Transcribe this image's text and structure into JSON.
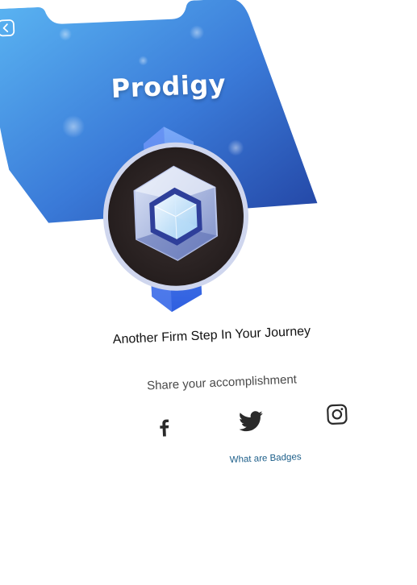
{
  "header": {
    "title": "Prodigy",
    "back_icon": "chevron-left-icon"
  },
  "badge": {
    "icon": "hexagon-gem-icon"
  },
  "main": {
    "tagline": "Another Firm Step In Your Journey",
    "share_label": "Share your accomplishment",
    "social": [
      {
        "name": "facebook",
        "icon": "facebook-icon"
      },
      {
        "name": "twitter",
        "icon": "twitter-icon"
      },
      {
        "name": "instagram",
        "icon": "instagram-icon"
      }
    ],
    "link_label": "What are Badges"
  },
  "colors": {
    "header_start": "#5ab0f0",
    "header_end": "#2648a8",
    "link": "#1d5f8a"
  }
}
